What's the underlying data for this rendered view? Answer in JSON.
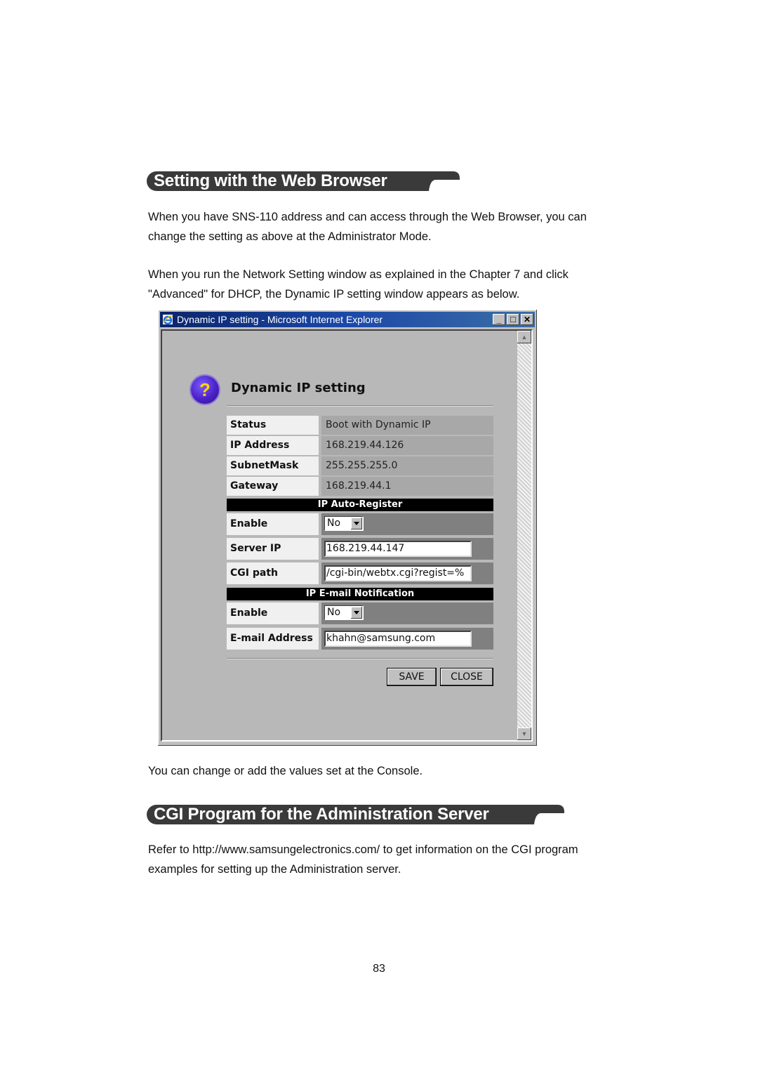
{
  "section1": {
    "heading": "Setting with the Web Browser",
    "para1": "When you have SNS-110 address and can access through the Web Browser, you can change the setting as above at the Administrator Mode.",
    "para1_lines": [
      "When you have SNS-110 address and can access through the Web Browser, you can",
      "change the setting as above at the Administrator Mode."
    ],
    "para2_lines": [
      "When you run the Network Setting window as explained in the Chapter 7 and click",
      "\"Advanced\" for DHCP, the Dynamic IP setting window appears as below."
    ]
  },
  "window": {
    "title": "Dynamic IP setting - Microsoft Internet Explorer",
    "minimize": "_",
    "maximize": "□",
    "close": "✕",
    "scroll_up": "▲",
    "scroll_down": "▼",
    "dialog_title": "Dynamic IP setting",
    "help_glyph": "?",
    "status": [
      {
        "label": "Status",
        "value": "Boot with Dynamic IP"
      },
      {
        "label": "IP Address",
        "value": "168.219.44.126"
      },
      {
        "label": "SubnetMask",
        "value": "255.255.255.0"
      },
      {
        "label": "Gateway",
        "value": "168.219.44.1"
      }
    ],
    "auto_register": {
      "header": "IP Auto-Register",
      "enable_label": "Enable",
      "enable_value": "No",
      "server_ip_label": "Server IP",
      "server_ip_value": "168.219.44.147",
      "cgi_path_label": "CGI path",
      "cgi_path_value": "/cgi-bin/webtx.cgi?regist=%"
    },
    "email_notification": {
      "header": "IP E-mail Notification",
      "enable_label": "Enable",
      "enable_value": "No",
      "email_label": "E-mail Address",
      "email_value": "khahn@samsung.com"
    },
    "save_label": "SAVE",
    "close_label": "CLOSE"
  },
  "after_window_text": "You can change or add the values set at the Console.",
  "section2": {
    "heading": "CGI Program for the Administration Server",
    "para_lines": [
      "Refer to http://www.samsungelectronics.com/ to get information on the CGI program",
      "examples for setting up the Administration server."
    ]
  },
  "page_number": "83"
}
